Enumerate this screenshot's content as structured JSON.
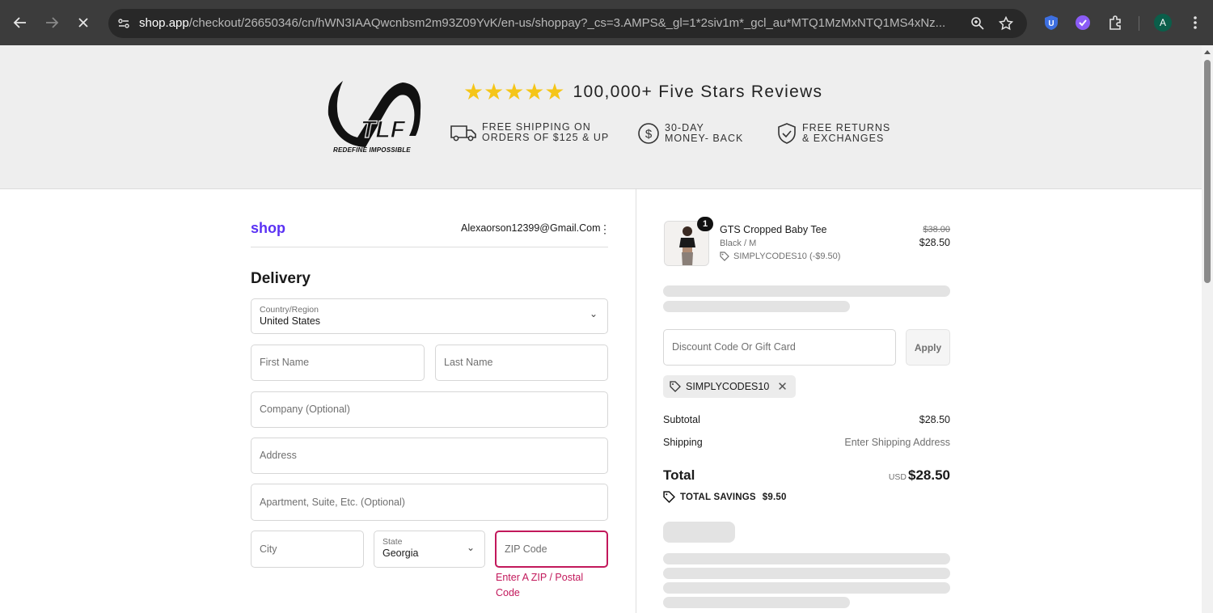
{
  "browser": {
    "url_host": "shop.app",
    "url_path": "/checkout/26650346/cn/hWN3IAAQwcnbsm2m93Z09YvK/en-us/shoppay?_cs=3.AMPS&_gl=1*2siv1m*_gcl_au*MTQ1MzMxNTQ1MS4xNz...",
    "avatar_letter": "A"
  },
  "banner": {
    "brand": "TLF",
    "tagline": "REDEFINE IMPOSSIBLE",
    "stars": "★★★★★",
    "reviews": "100,000+ Five Stars Reviews",
    "features": [
      {
        "text": "FREE SHIPPING  ON\nORDERS OF $125 & UP"
      },
      {
        "text": "30-DAY\nMONEY- BACK"
      },
      {
        "text": "FREE RETURNS\n& EXCHANGES"
      }
    ]
  },
  "checkout": {
    "shop_logo": "shop",
    "email": "Alexaorson12399@Gmail.Com",
    "kebab": "⋮",
    "section_title": "Delivery",
    "country_label": "Country/Region",
    "country_value": "United States",
    "first_name_placeholder": "First Name",
    "last_name_placeholder": "Last Name",
    "company_placeholder": "Company (Optional)",
    "address_placeholder": "Address",
    "apartment_placeholder": "Apartment, Suite, Etc. (Optional)",
    "city_placeholder": "City",
    "state_label": "State",
    "state_value": "Georgia",
    "zip_placeholder": "ZIP Code",
    "zip_error": "Enter A ZIP / Postal Code",
    "chevron": "⌄"
  },
  "summary": {
    "product": {
      "quantity": "1",
      "name": "GTS Cropped Baby Tee",
      "variant": "Black / M",
      "discount": "SIMPLYCODES10 (-$9.50)",
      "original_price": "$38.00",
      "price": "$28.50"
    },
    "discount_placeholder": "Discount Code Or Gift Card",
    "apply_label": "Apply",
    "applied_code": "SIMPLYCODES10",
    "remove_glyph": "✕",
    "subtotal_label": "Subtotal",
    "subtotal_value": "$28.50",
    "shipping_label": "Shipping",
    "shipping_value": "Enter Shipping Address",
    "total_label": "Total",
    "total_currency": "USD",
    "total_value": "$28.50",
    "savings_label": "TOTAL SAVINGS",
    "savings_value": "$9.50"
  },
  "colors": {
    "shop_purple": "#5a31f4",
    "error": "#c2185b",
    "star": "#f5c518"
  }
}
